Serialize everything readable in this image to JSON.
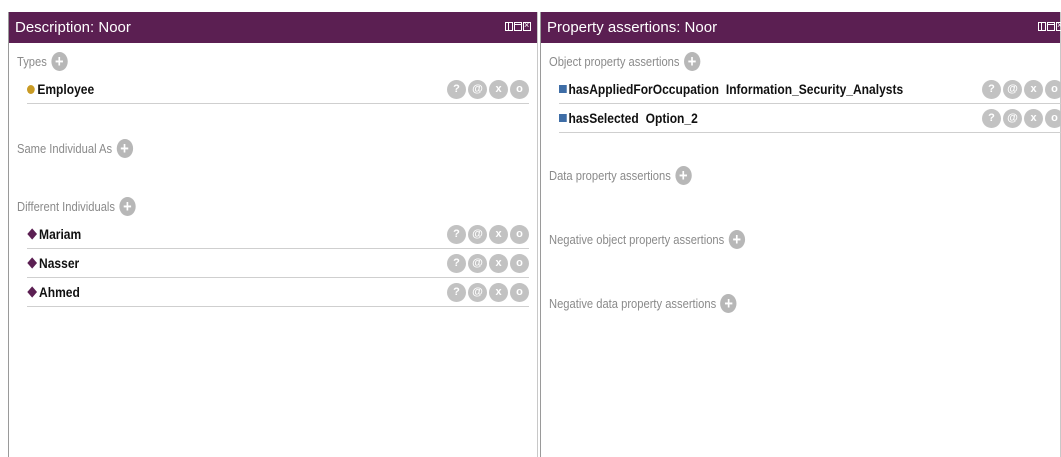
{
  "description_panel": {
    "title": "Description: Noor",
    "types": {
      "label": "Types",
      "items": [
        {
          "name": "Employee"
        }
      ]
    },
    "same_individual": {
      "label": "Same Individual As"
    },
    "different_individuals": {
      "label": "Different Individuals",
      "items": [
        {
          "name": "Mariam"
        },
        {
          "name": "Nasser"
        },
        {
          "name": "Ahmed"
        }
      ]
    }
  },
  "property_panel": {
    "title": "Property assertions: Noor",
    "object_props": {
      "label": "Object property assertions",
      "items": [
        {
          "property": "hasAppliedForOccupation",
          "value": "Information_Security_Analysts"
        },
        {
          "property": "hasSelected",
          "value": "Option_2"
        }
      ]
    },
    "data_props": {
      "label": "Data property assertions"
    },
    "neg_object_props": {
      "label": "Negative object property assertions"
    },
    "neg_data_props": {
      "label": "Negative data property assertions"
    }
  },
  "row_actions": {
    "annotate": "?",
    "at": "@",
    "delete": "x",
    "edit": "o"
  },
  "add_symbol": "+",
  "colors": {
    "titlebar": "#5b1f52",
    "class_icon": "#c99b24",
    "individual_icon": "#5b1f52",
    "property_icon": "#3e6da6"
  }
}
